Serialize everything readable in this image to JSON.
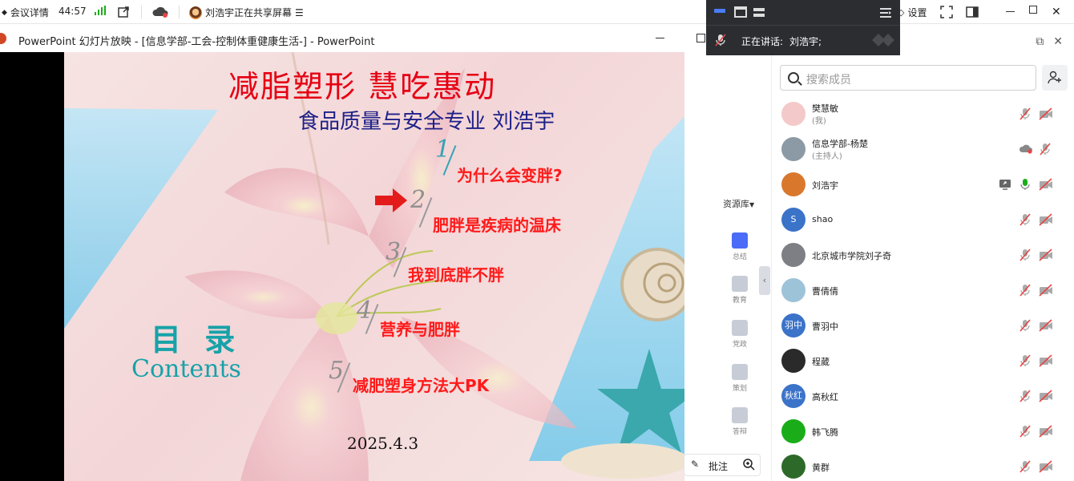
{
  "topbar": {
    "meeting_details": "会议详情",
    "elapsed": "44:57",
    "sharing_status": "刘浩宇正在共享屏幕",
    "settings": "设置"
  },
  "float_panel": {
    "speaking_label": "正在讲话:",
    "speaking_name": "刘浩宇;"
  },
  "ppt_window": {
    "title": "PowerPoint 幻灯片放映 - [信息学部-工会-控制体重健康生活-] - PowerPoint"
  },
  "slide": {
    "title": "减脂塑形  慧吃惠动",
    "subtitle": "食品质量与安全专业  刘浩宇",
    "toc_heading": "目 录",
    "toc_heading_en": "Contents",
    "items": [
      {
        "num": "1",
        "label": "为什么会变胖?"
      },
      {
        "num": "2",
        "label": "肥胖是疾病的温床"
      },
      {
        "num": "3",
        "label": "我到底胖不胖"
      },
      {
        "num": "4",
        "label": "营养与肥胖"
      },
      {
        "num": "5",
        "label": "减肥塑身方法大PK"
      }
    ],
    "date": "2025.4.3"
  },
  "resource_toolbar": {
    "header": "资源库",
    "tools": [
      "总结",
      "教育",
      "党政",
      "策划",
      "答辩"
    ]
  },
  "annotate": {
    "label": "批注"
  },
  "members_panel": {
    "search_placeholder": "搜索成员",
    "members": [
      {
        "name": "樊慧敏",
        "role": "(我)",
        "avatar_color": "#f3c9c9",
        "avatar_text": ""
      },
      {
        "name": "信息学部-杨楚",
        "role": "(主持人)",
        "avatar_color": "#8c9aa5",
        "avatar_text": ""
      },
      {
        "name": "刘浩宇",
        "role": "",
        "avatar_color": "#d9782d",
        "avatar_text": ""
      },
      {
        "name": "shao",
        "role": "",
        "avatar_color": "#3b73c9",
        "avatar_text": "S"
      },
      {
        "name": "北京城市学院刘子奇",
        "role": "",
        "avatar_color": "#7d7f85",
        "avatar_text": ""
      },
      {
        "name": "曹倩倩",
        "role": "",
        "avatar_color": "#9dc3d9",
        "avatar_text": ""
      },
      {
        "name": "曹羽中",
        "role": "",
        "avatar_color": "#3b73c9",
        "avatar_text": "羽中"
      },
      {
        "name": "程葳",
        "role": "",
        "avatar_color": "#2a2a2a",
        "avatar_text": ""
      },
      {
        "name": "高秋红",
        "role": "",
        "avatar_color": "#3b73c9",
        "avatar_text": "秋红"
      },
      {
        "name": "韩飞腾",
        "role": "",
        "avatar_color": "#1aad19",
        "avatar_text": ""
      },
      {
        "name": "黄群",
        "role": "",
        "avatar_color": "#2d6a2a",
        "avatar_text": ""
      }
    ]
  },
  "colors": {
    "accent": "#3b73c9",
    "muted_red": "#e64545",
    "slide_red": "#e60012",
    "slide_navy": "#1d2088",
    "teal": "#17a2a8"
  }
}
